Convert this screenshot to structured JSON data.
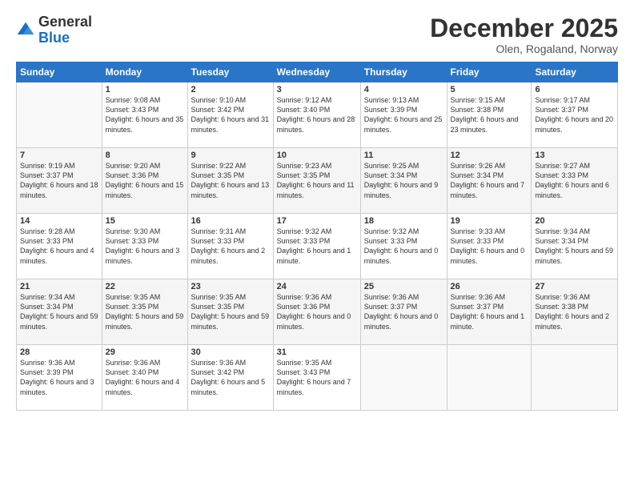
{
  "header": {
    "logo_general": "General",
    "logo_blue": "Blue",
    "month_title": "December 2025",
    "location": "Olen, Rogaland, Norway"
  },
  "weekdays": [
    "Sunday",
    "Monday",
    "Tuesday",
    "Wednesday",
    "Thursday",
    "Friday",
    "Saturday"
  ],
  "rows": [
    [
      {
        "num": "",
        "info": ""
      },
      {
        "num": "1",
        "info": "Sunrise: 9:08 AM\nSunset: 3:43 PM\nDaylight: 6 hours\nand 35 minutes."
      },
      {
        "num": "2",
        "info": "Sunrise: 9:10 AM\nSunset: 3:42 PM\nDaylight: 6 hours\nand 31 minutes."
      },
      {
        "num": "3",
        "info": "Sunrise: 9:12 AM\nSunset: 3:40 PM\nDaylight: 6 hours\nand 28 minutes."
      },
      {
        "num": "4",
        "info": "Sunrise: 9:13 AM\nSunset: 3:39 PM\nDaylight: 6 hours\nand 25 minutes."
      },
      {
        "num": "5",
        "info": "Sunrise: 9:15 AM\nSunset: 3:38 PM\nDaylight: 6 hours\nand 23 minutes."
      },
      {
        "num": "6",
        "info": "Sunrise: 9:17 AM\nSunset: 3:37 PM\nDaylight: 6 hours\nand 20 minutes."
      }
    ],
    [
      {
        "num": "7",
        "info": "Sunrise: 9:19 AM\nSunset: 3:37 PM\nDaylight: 6 hours\nand 18 minutes."
      },
      {
        "num": "8",
        "info": "Sunrise: 9:20 AM\nSunset: 3:36 PM\nDaylight: 6 hours\nand 15 minutes."
      },
      {
        "num": "9",
        "info": "Sunrise: 9:22 AM\nSunset: 3:35 PM\nDaylight: 6 hours\nand 13 minutes."
      },
      {
        "num": "10",
        "info": "Sunrise: 9:23 AM\nSunset: 3:35 PM\nDaylight: 6 hours\nand 11 minutes."
      },
      {
        "num": "11",
        "info": "Sunrise: 9:25 AM\nSunset: 3:34 PM\nDaylight: 6 hours\nand 9 minutes."
      },
      {
        "num": "12",
        "info": "Sunrise: 9:26 AM\nSunset: 3:34 PM\nDaylight: 6 hours\nand 7 minutes."
      },
      {
        "num": "13",
        "info": "Sunrise: 9:27 AM\nSunset: 3:33 PM\nDaylight: 6 hours\nand 6 minutes."
      }
    ],
    [
      {
        "num": "14",
        "info": "Sunrise: 9:28 AM\nSunset: 3:33 PM\nDaylight: 6 hours\nand 4 minutes."
      },
      {
        "num": "15",
        "info": "Sunrise: 9:30 AM\nSunset: 3:33 PM\nDaylight: 6 hours\nand 3 minutes."
      },
      {
        "num": "16",
        "info": "Sunrise: 9:31 AM\nSunset: 3:33 PM\nDaylight: 6 hours\nand 2 minutes."
      },
      {
        "num": "17",
        "info": "Sunrise: 9:32 AM\nSunset: 3:33 PM\nDaylight: 6 hours\nand 1 minute."
      },
      {
        "num": "18",
        "info": "Sunrise: 9:32 AM\nSunset: 3:33 PM\nDaylight: 6 hours\nand 0 minutes."
      },
      {
        "num": "19",
        "info": "Sunrise: 9:33 AM\nSunset: 3:33 PM\nDaylight: 6 hours\nand 0 minutes."
      },
      {
        "num": "20",
        "info": "Sunrise: 9:34 AM\nSunset: 3:34 PM\nDaylight: 5 hours\nand 59 minutes."
      }
    ],
    [
      {
        "num": "21",
        "info": "Sunrise: 9:34 AM\nSunset: 3:34 PM\nDaylight: 5 hours\nand 59 minutes."
      },
      {
        "num": "22",
        "info": "Sunrise: 9:35 AM\nSunset: 3:35 PM\nDaylight: 5 hours\nand 59 minutes."
      },
      {
        "num": "23",
        "info": "Sunrise: 9:35 AM\nSunset: 3:35 PM\nDaylight: 5 hours\nand 59 minutes."
      },
      {
        "num": "24",
        "info": "Sunrise: 9:36 AM\nSunset: 3:36 PM\nDaylight: 6 hours\nand 0 minutes."
      },
      {
        "num": "25",
        "info": "Sunrise: 9:36 AM\nSunset: 3:37 PM\nDaylight: 6 hours\nand 0 minutes."
      },
      {
        "num": "26",
        "info": "Sunrise: 9:36 AM\nSunset: 3:37 PM\nDaylight: 6 hours\nand 1 minute."
      },
      {
        "num": "27",
        "info": "Sunrise: 9:36 AM\nSunset: 3:38 PM\nDaylight: 6 hours\nand 2 minutes."
      }
    ],
    [
      {
        "num": "28",
        "info": "Sunrise: 9:36 AM\nSunset: 3:39 PM\nDaylight: 6 hours\nand 3 minutes."
      },
      {
        "num": "29",
        "info": "Sunrise: 9:36 AM\nSunset: 3:40 PM\nDaylight: 6 hours\nand 4 minutes."
      },
      {
        "num": "30",
        "info": "Sunrise: 9:36 AM\nSunset: 3:42 PM\nDaylight: 6 hours\nand 5 minutes."
      },
      {
        "num": "31",
        "info": "Sunrise: 9:35 AM\nSunset: 3:43 PM\nDaylight: 6 hours\nand 7 minutes."
      },
      {
        "num": "",
        "info": ""
      },
      {
        "num": "",
        "info": ""
      },
      {
        "num": "",
        "info": ""
      }
    ]
  ]
}
